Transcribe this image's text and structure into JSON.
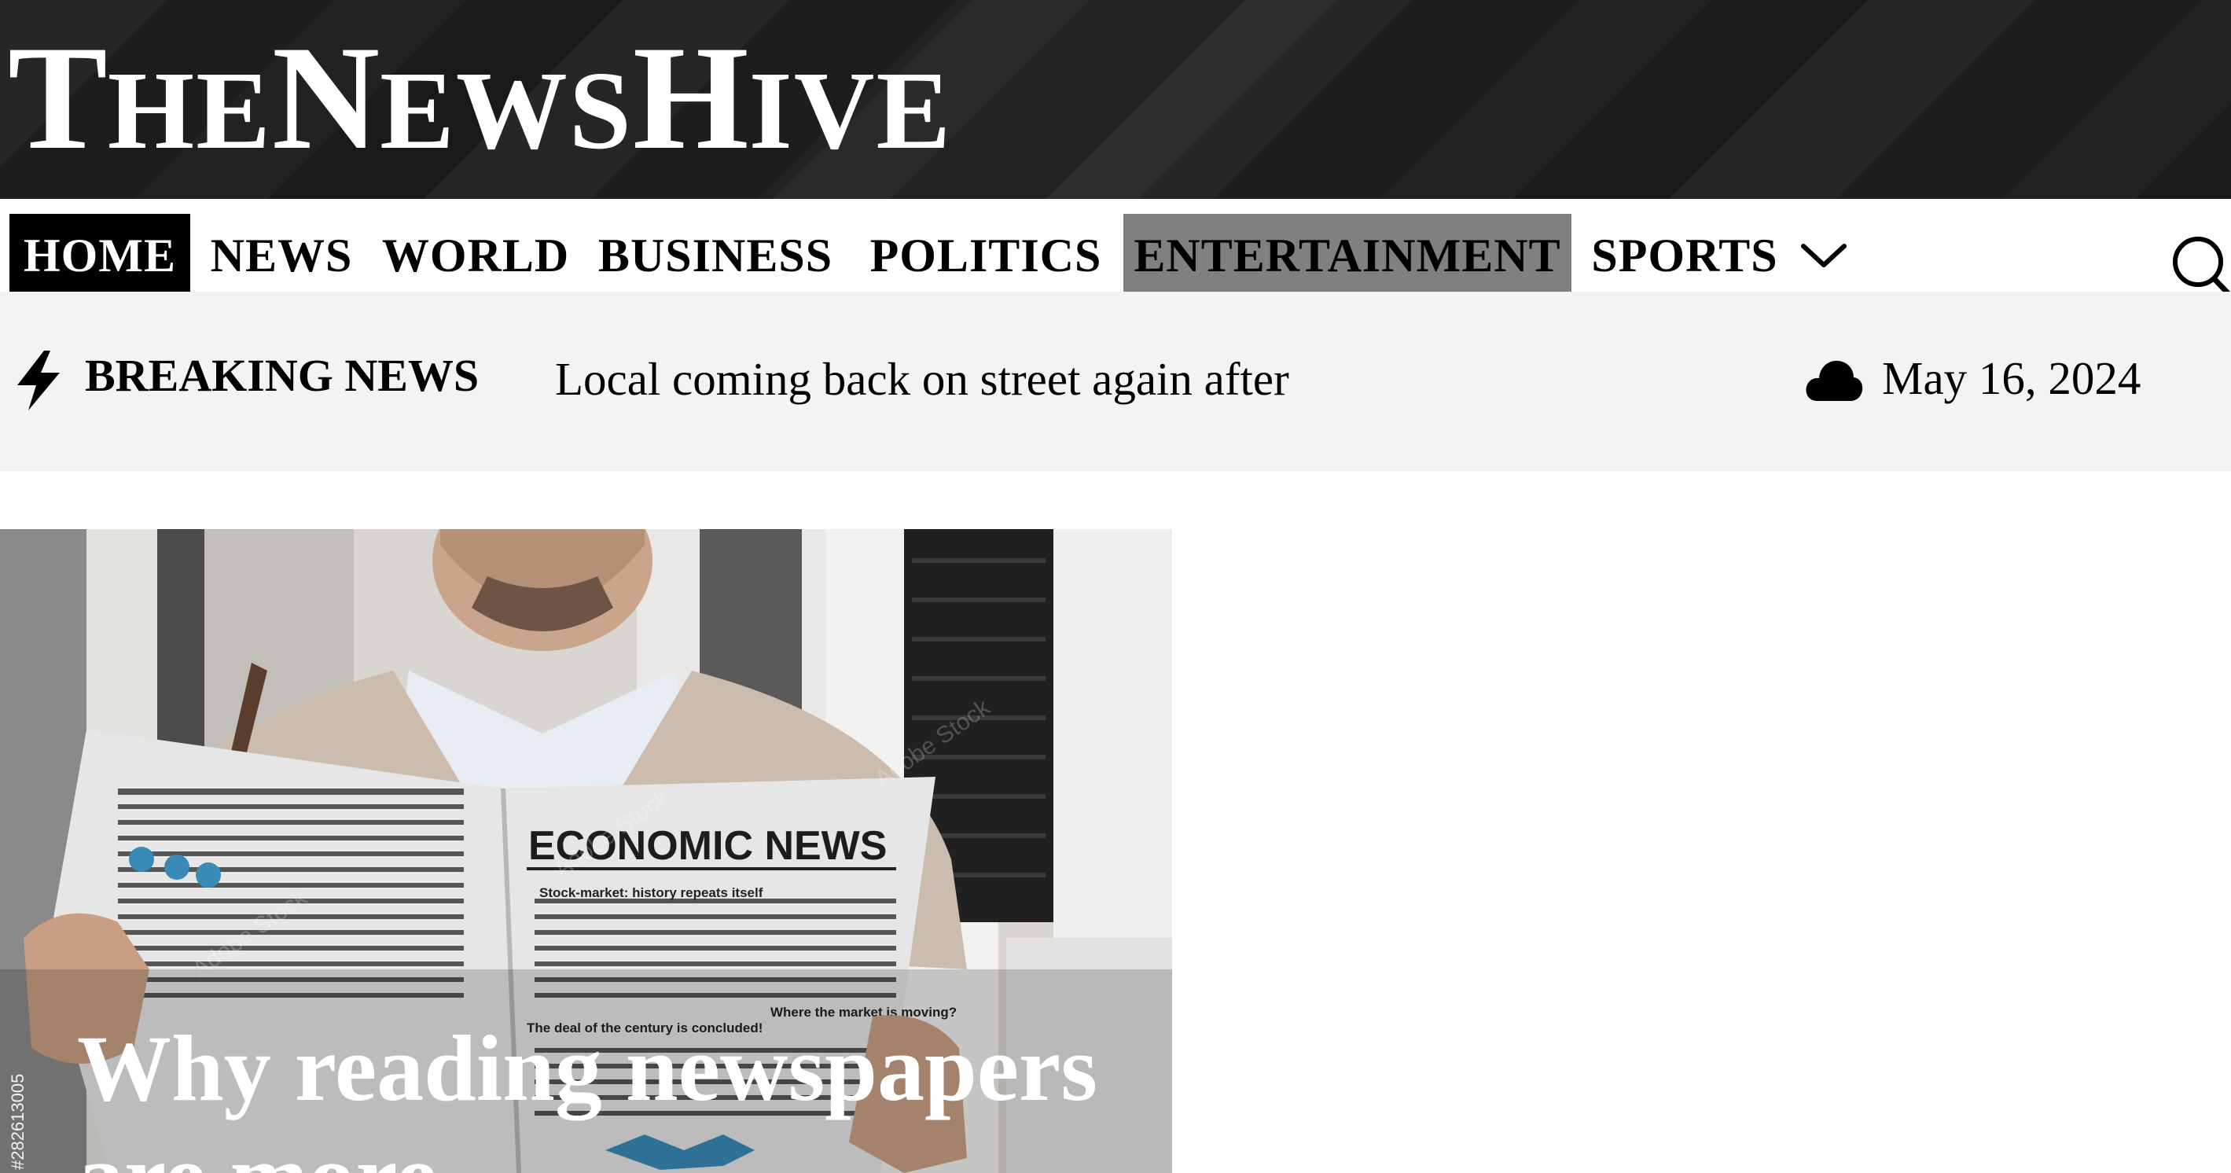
{
  "site": {
    "logo_parts": [
      "T",
      "HE",
      "N",
      "EWS",
      "H",
      "IVE"
    ]
  },
  "nav": {
    "items": [
      {
        "label": "HOME",
        "state": "active"
      },
      {
        "label": "NEWS",
        "state": "default"
      },
      {
        "label": "WORLD",
        "state": "default"
      },
      {
        "label": "BUSINESS",
        "state": "default"
      },
      {
        "label": "POLITICS",
        "state": "default"
      },
      {
        "label": "ENTERTAINMENT",
        "state": "hover"
      },
      {
        "label": "SPORTS",
        "state": "default",
        "has_dropdown": true
      }
    ],
    "dropdown_icon": "chevron-down-icon",
    "search_icon": "search-icon"
  },
  "breaking": {
    "icon": "lightning-bolt-icon",
    "label": "BREAKING NEWS",
    "headline": "Local coming back on street again after",
    "weather_icon": "cloud-icon",
    "date": "May 16, 2024"
  },
  "hero": {
    "title": "Why reading newspapers are more",
    "image_id_text": "#282613005",
    "image_watermark": "Adobe Stock",
    "newspaper_headline": "ECONOMIC NEWS",
    "newspaper_sub1": "Stock-market: history repeats itself",
    "newspaper_sub2": "The deal of the century is concluded!",
    "newspaper_sub3": "Where the market is moving?"
  },
  "colors": {
    "masthead_bg": "#1f1f1f",
    "nav_active_bg": "#000000",
    "nav_hover_bg": "#808080",
    "breaking_bg": "#f3f3f3"
  }
}
